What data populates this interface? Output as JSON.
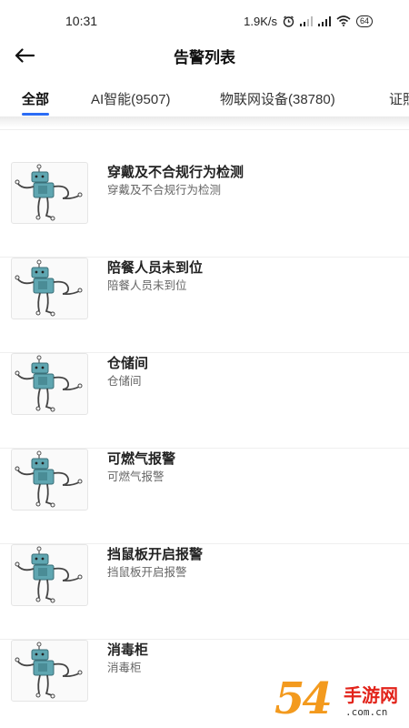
{
  "status_bar": {
    "time": "10:31",
    "network_speed": "1.9K/s",
    "battery": "64",
    "icons": [
      "alarm-icon",
      "signal-icon",
      "signal-icon",
      "wifi-icon",
      "battery-icon"
    ]
  },
  "header": {
    "title": "告警列表",
    "back_icon": "arrow-left-icon"
  },
  "tabs": [
    {
      "label": "全部",
      "active": true
    },
    {
      "label": "AI智能(9507)",
      "active": false
    },
    {
      "label": "物联网设备(38780)",
      "active": false
    },
    {
      "label": "证照",
      "active": false
    }
  ],
  "accent_color": "#2b6cf5",
  "alarms": [
    {
      "title": "穿戴及不合规行为检测",
      "subtitle": "穿戴及不合规行为检测",
      "icon": "robot-icon"
    },
    {
      "title": "陪餐人员未到位",
      "subtitle": "陪餐人员未到位",
      "icon": "robot-icon"
    },
    {
      "title": "仓储间",
      "subtitle": "仓储间",
      "icon": "robot-icon"
    },
    {
      "title": "可燃气报警",
      "subtitle": "可燃气报警",
      "icon": "robot-icon"
    },
    {
      "title": "挡鼠板开启报警",
      "subtitle": "挡鼠板开启报警",
      "icon": "robot-icon"
    },
    {
      "title": "消毒柜",
      "subtitle": "消毒柜",
      "icon": "robot-icon"
    }
  ],
  "watermark": {
    "digits": "54",
    "name": "手游网",
    "domain": ".com.cn"
  }
}
